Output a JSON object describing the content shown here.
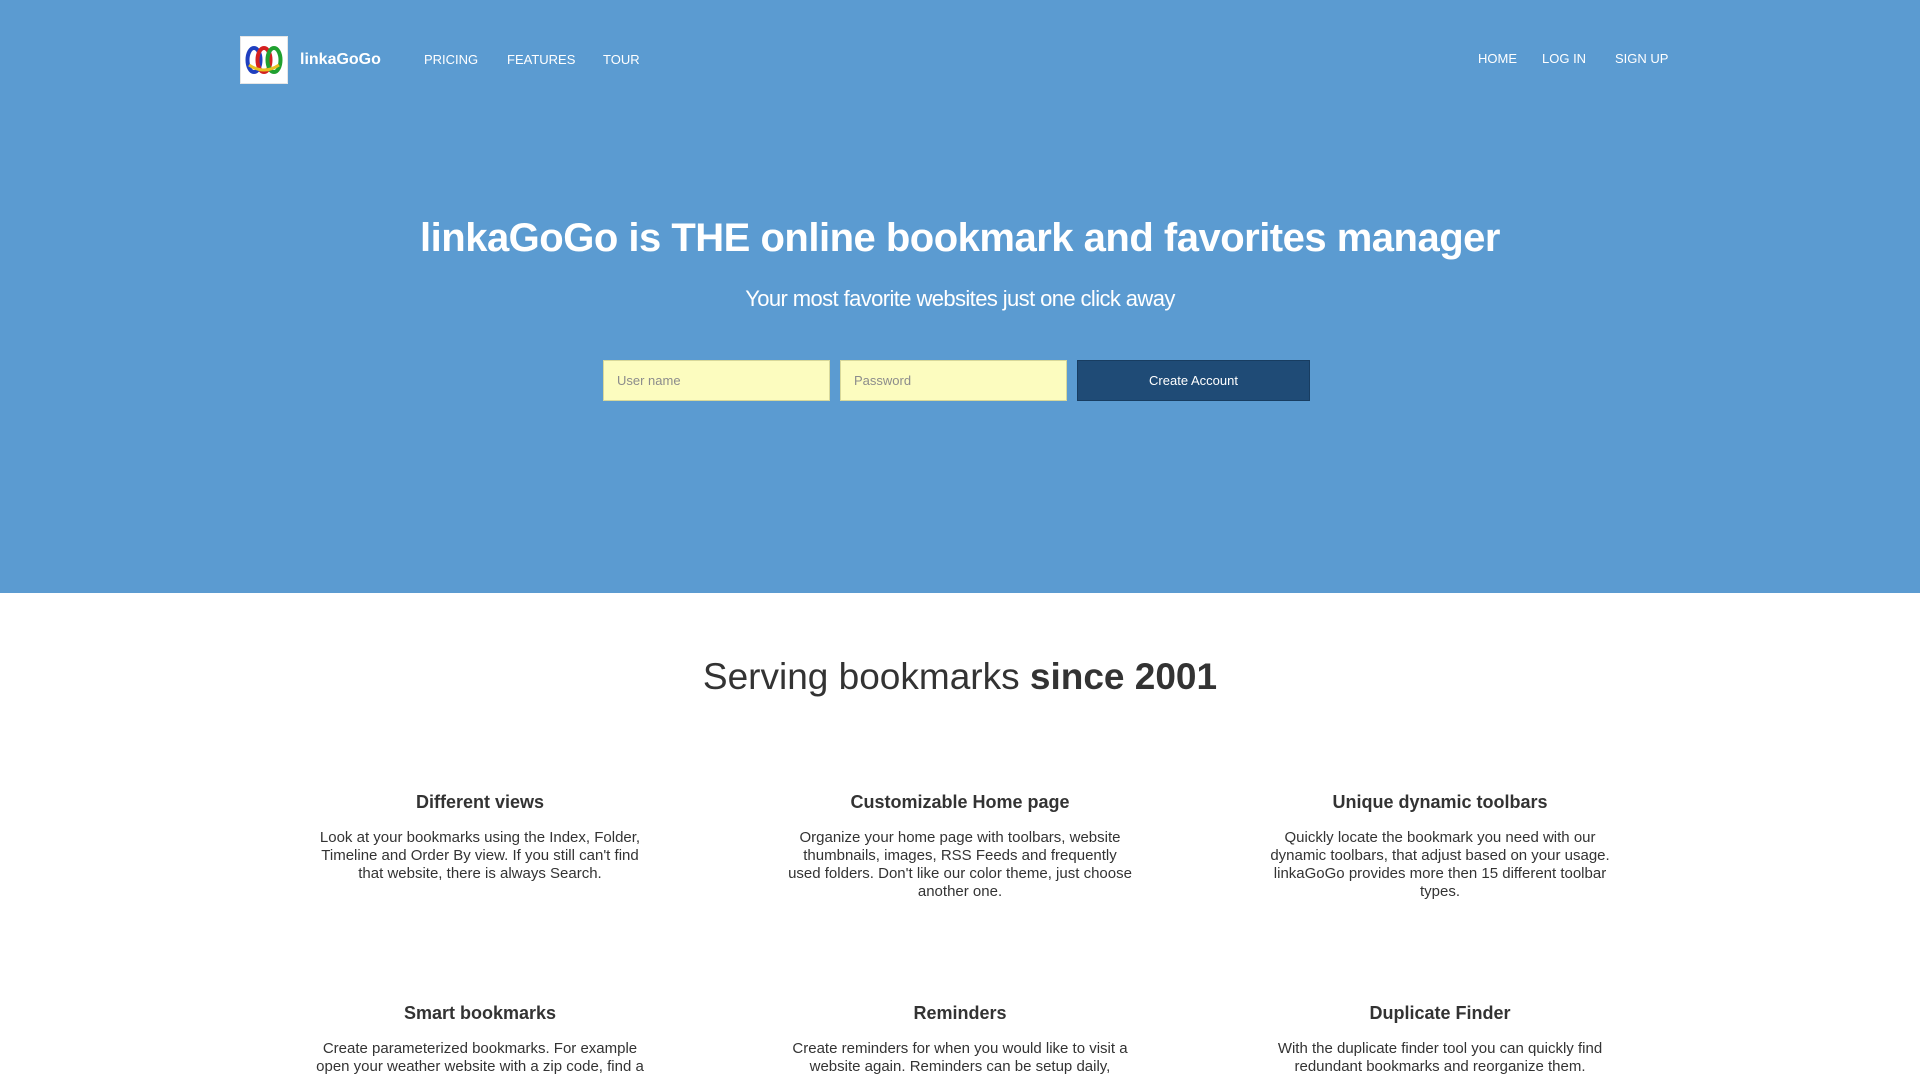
{
  "brand": {
    "name": "linkaGoGo",
    "logo_icon": "interlocking-rings-logo-icon",
    "colors": {
      "hero_bg": "#5b9bd1",
      "button_bg": "#1f4b76",
      "input_bg": "#fcfcbf"
    }
  },
  "nav": {
    "left": [
      {
        "label": "PRICING"
      },
      {
        "label": "FEATURES"
      },
      {
        "label": "TOUR"
      }
    ],
    "right": [
      {
        "label": "HOME"
      },
      {
        "label": "LOG IN"
      },
      {
        "label": "SIGN UP"
      }
    ]
  },
  "hero": {
    "title": "linkaGoGo is THE online bookmark and favorites manager",
    "subtitle": "Your most favorite websites just one click away",
    "username_placeholder": "User name",
    "password_placeholder": "Password",
    "username_value": "",
    "password_value": "",
    "create_button": "Create Account"
  },
  "section": {
    "title_normal": "Serving bookmarks ",
    "title_bold": "since 2001"
  },
  "features": [
    {
      "title": "Different views",
      "text": "Look at your bookmarks using the Index, Folder, Timeline and Order By view. If you still can't find that website, there is always Search."
    },
    {
      "title": "Customizable Home page",
      "text": "Organize your home page with toolbars, website thumbnails, images, RSS Feeds and frequently used folders. Don't like our color theme, just choose another one."
    },
    {
      "title": "Unique dynamic toolbars",
      "text": "Quickly locate the bookmark you need with our dynamic toolbars, that adjust based on your usage. linkaGoGo provides more then 15 different toolbar types."
    },
    {
      "title": "Smart bookmarks",
      "text": "Create parameterized bookmarks. For example open your weather website with a zip code, find a"
    },
    {
      "title": "Reminders",
      "text": "Create reminders for when you would like to visit a website again. Reminders can be setup daily,"
    },
    {
      "title": "Duplicate Finder",
      "text": "With the duplicate finder tool you can quickly find redundant bookmarks and reorganize them."
    }
  ]
}
